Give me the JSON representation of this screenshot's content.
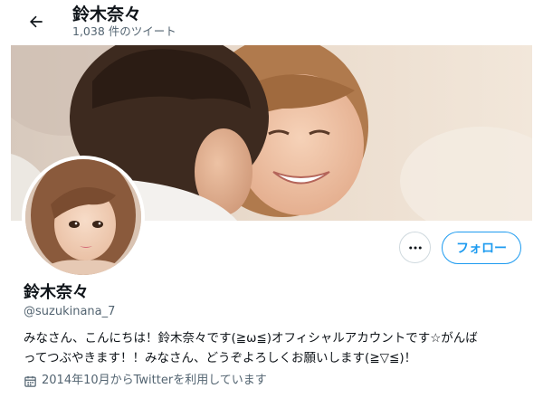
{
  "header": {
    "title": "鈴木奈々",
    "tweet_count": "1,038 件のツイート"
  },
  "profile": {
    "name": "鈴木奈々",
    "handle": "@suzukinana_7",
    "bio_line1": "みなさん、こんにちは！鈴木奈々です(≧ω≦)オフィシャルアカウントです☆がんば",
    "bio_line2": "ってつぶやきます！！みなさん、どうぞよろしくお願いします(≧▽≦)！",
    "joined": "2014年10月からTwitterを利用しています"
  },
  "actions": {
    "follow_label": "フォロー"
  },
  "colors": {
    "accent": "#1d9bf0",
    "secondary_text": "#536471",
    "primary_text": "#0f1419",
    "border": "#cfd9de"
  },
  "icons": {
    "back": "arrow-left-icon",
    "more": "more-dots-icon",
    "joined": "calendar-icon"
  }
}
